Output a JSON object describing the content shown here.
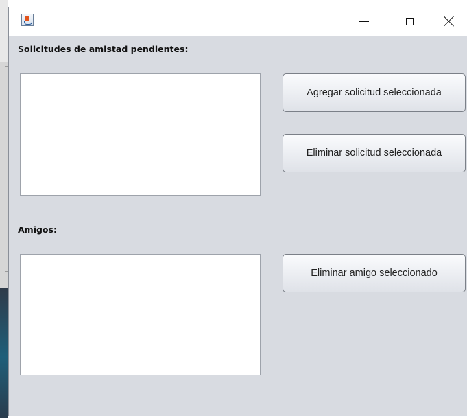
{
  "window": {
    "title": "",
    "controls": {
      "minimize": "minimize-icon",
      "maximize": "maximize-icon",
      "close": "close-icon"
    }
  },
  "requests": {
    "label": "Solicitudes de amistad pendientes:",
    "items": []
  },
  "friends": {
    "label": "Amigos:",
    "items": []
  },
  "buttons": {
    "add_request": "Agregar solicitud seleccionada",
    "remove_request": "Eliminar solicitud seleccionada",
    "remove_friend": "Eliminar amigo seleccionado"
  },
  "colors": {
    "window_bg": "#d8dbe1",
    "titlebar_bg": "#ffffff",
    "list_bg": "#ffffff"
  }
}
